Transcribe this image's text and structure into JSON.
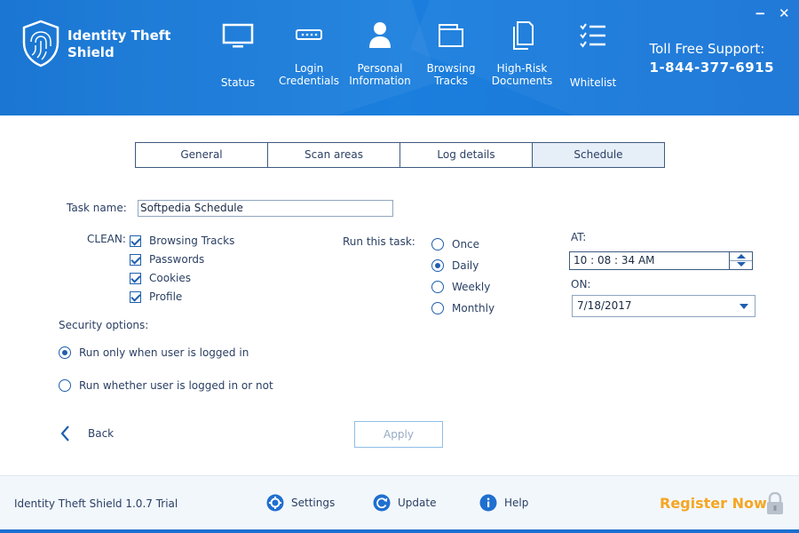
{
  "app": {
    "brand_line1": "Identity Theft",
    "brand_line2": "Shield"
  },
  "nav": {
    "status": "Status",
    "login_1": "Login",
    "login_2": "Credentials",
    "personal_1": "Personal",
    "personal_2": "Information",
    "browsing_1": "Browsing",
    "browsing_2": "Tracks",
    "highrisk_1": "High-Risk",
    "highrisk_2": "Documents",
    "whitelist": "Whitelist"
  },
  "support": {
    "label": "Toll Free Support:",
    "phone": "1-844-377-6915"
  },
  "window": {
    "minimize": "−",
    "close": "✕"
  },
  "tabs": [
    "General",
    "Scan areas",
    "Log details",
    "Schedule"
  ],
  "form": {
    "task_name_label": "Task name:",
    "task_name_value": "Softpedia Schedule",
    "clean_label": "CLEAN:",
    "clean_items": [
      "Browsing Tracks",
      "Passwords",
      "Cookies",
      "Profile"
    ],
    "run_label": "Run this task:",
    "run_options": [
      "Once",
      "Daily",
      "Weekly",
      "Monthly"
    ],
    "run_selected": "Daily",
    "at_label": "AT:",
    "time_value": "10 : 08 : 34  AM",
    "on_label": "ON:",
    "date_value": "7/18/2017",
    "security_label": "Security options:",
    "security_options": [
      "Run only when user is logged in",
      "Run whether user is logged in or not"
    ],
    "back_label": "Back",
    "apply_label": "Apply"
  },
  "footer": {
    "version": "Identity Theft Shield 1.0.7 Trial",
    "settings": "Settings",
    "update": "Update",
    "help": "Help",
    "register": "Register Now"
  },
  "colors": {
    "header_blue": "#1b7fde",
    "accent_blue": "#1f5fae",
    "register_orange": "#f5a623"
  }
}
